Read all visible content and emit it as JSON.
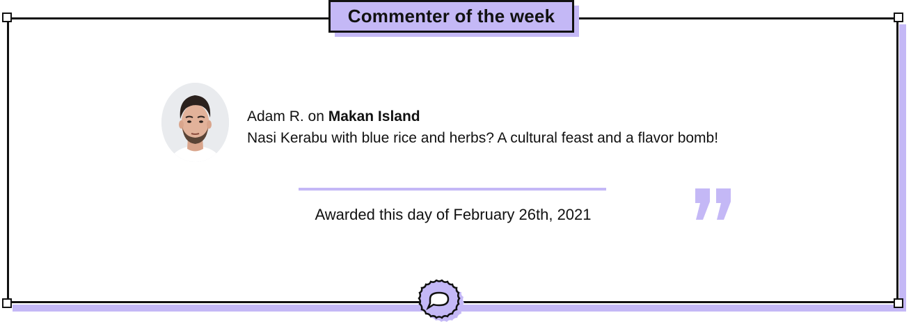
{
  "card": {
    "title": "Commenter of the week",
    "accent_color": "#c4b8f6",
    "border_color": "#111111"
  },
  "comment": {
    "author": "Adam R.",
    "connector": " on ",
    "place": "Makan Island",
    "text": "Nasi Kerabu with blue rice and herbs? A cultural feast and a flavor bomb!"
  },
  "award": {
    "text": "Awarded this day of February 26th, 2021"
  },
  "icons": {
    "avatar": "user-avatar-photo",
    "quote": "closing-quote-icon",
    "badge": "speech-bubble-badge-icon",
    "handles": "corner-handle-icon"
  }
}
